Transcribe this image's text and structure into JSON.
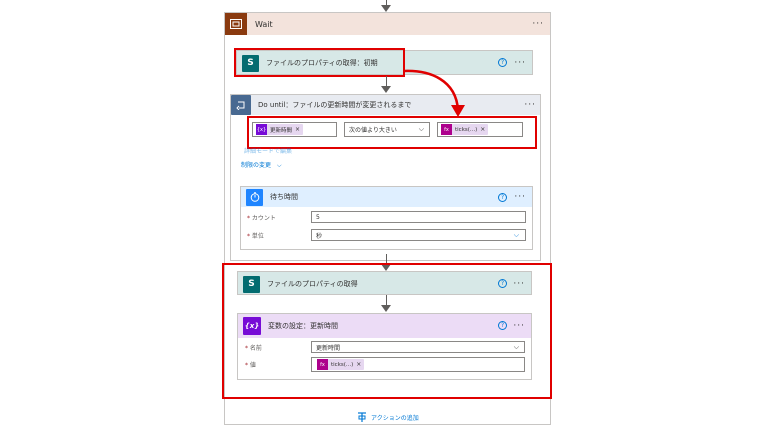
{
  "wait_block": {
    "title": "Wait",
    "more": "···"
  },
  "get_props_initial": {
    "title": "ファイルのプロパティの取得：初期",
    "help": "?",
    "more": "···"
  },
  "do_until": {
    "title": "Do until：ファイルの更新時間が変更されるまで",
    "more": "···",
    "condition": {
      "left_token": "更新時間",
      "operator": "次の値より大きい",
      "right_token": "ticks(...)"
    },
    "edit_links": "詳細モードで編集",
    "limits_link": "制限の変更"
  },
  "delay": {
    "title": "待ち時間",
    "help": "?",
    "more": "···",
    "count_label": "カウント",
    "count_value": "5",
    "unit_label": "単位",
    "unit_value": "秒"
  },
  "get_props": {
    "title": "ファイルのプロパティの取得",
    "help": "?",
    "more": "···"
  },
  "set_var": {
    "title": "変数の設定：更新時間",
    "help": "?",
    "more": "···",
    "name_label": "名前",
    "name_value": "更新時間",
    "value_label": "値",
    "value_token": "ticks(...)"
  },
  "add_action": {
    "label": "アクションの追加"
  },
  "colors": {
    "sharepoint": "#036c70",
    "variable": "#770bd6",
    "expression": "#ad008c",
    "delay": "#1f85ff",
    "highlight": "#e00000"
  }
}
